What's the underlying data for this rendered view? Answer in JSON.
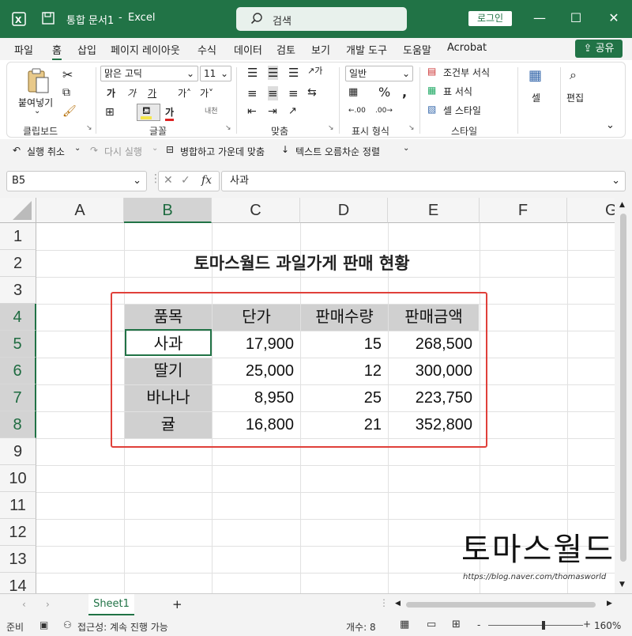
{
  "titlebar": {
    "filename": "통합 문서1",
    "sep": "-",
    "app": "Excel",
    "search_placeholder": "검색",
    "login": "로그인",
    "minimize": "—",
    "restore": "☐",
    "close": "✕"
  },
  "menu": {
    "items": [
      "파일",
      "홈",
      "삽입",
      "페이지 레이아웃",
      "수식",
      "데이터",
      "검토",
      "보기",
      "개발 도구",
      "도움말",
      "Acrobat"
    ],
    "share": "공유"
  },
  "ribbon": {
    "paste": "붙여넣기",
    "clipboard": "클립보드",
    "font_name": "맑은 고딕",
    "font_size": "11",
    "font_group": "글꼴",
    "align_group": "맞춤",
    "number_format": "일반",
    "number_group": "표시 형식",
    "cond_format": "조건부 서식",
    "table_format": "표 서식",
    "cell_style": "셀 스타일",
    "style_group": "스타일",
    "cells": "셀",
    "edit": "편집"
  },
  "qat": {
    "undo": "실행 취소",
    "redo": "다시 실행",
    "merge": "병합하고 가운데 맞춤",
    "sort": "텍스트 오름차순 정렬"
  },
  "formula": {
    "namebox": "B5",
    "fx": "fx",
    "value": "사과"
  },
  "grid": {
    "columns": [
      "A",
      "B",
      "C",
      "D",
      "E",
      "F",
      "G"
    ],
    "rows": [
      "1",
      "2",
      "3",
      "4",
      "5",
      "6",
      "7",
      "8",
      "9",
      "10",
      "11",
      "12",
      "13",
      "14"
    ],
    "title": "토마스월드 과일가게 판매 현황",
    "headers": [
      "품목",
      "단가",
      "판매수량",
      "판매금액"
    ],
    "data": [
      [
        "사과",
        "17,900",
        "15",
        "268,500"
      ],
      [
        "딸기",
        "25,000",
        "12",
        "300,000"
      ],
      [
        "바나나",
        "8,950",
        "25",
        "223,750"
      ],
      [
        "귤",
        "16,800",
        "21",
        "352,800"
      ]
    ]
  },
  "watermark": {
    "text": "토마스월드",
    "url": "https://blog.naver.com/thomasworld"
  },
  "sheets": {
    "tab": "Sheet1",
    "add": "+"
  },
  "status": {
    "ready": "준비",
    "accessibility": "접근성: 계속 진행 가능",
    "count": "개수: 8",
    "zoom": "160%",
    "minus": "-",
    "plus": "+"
  },
  "colors": {
    "accent": "#217346",
    "highlight_border": "#e0403a",
    "header_fill": "#d0d0d0"
  }
}
